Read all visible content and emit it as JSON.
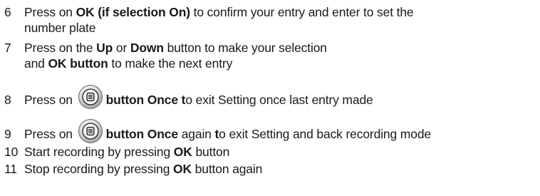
{
  "steps": [
    {
      "num": "6",
      "l1a": "Press on ",
      "l1b": "OK (if selection On)",
      "l1c": " to confirm your entry and enter to set the",
      "l2": "number plate"
    },
    {
      "num": "7",
      "l1a": "Press on the ",
      "l1b": "Up",
      "l1c": " or ",
      "l1d": "Down",
      "l1e": " button to make your selection",
      "l2a": "and ",
      "l2b": "OK button",
      "l2c": " to make the next entry"
    },
    {
      "num": "8",
      "pre": "Press on ",
      "bold": "button Once t",
      "post": "o exit Setting once last entry made",
      "icon": "menu-button-icon"
    },
    {
      "num": "9",
      "pre": "Press on ",
      "bold": "button Once",
      "mid": " again ",
      "bold2": "t",
      "post": "o exit Setting and back recording mode",
      "icon": "menu-button-icon"
    },
    {
      "num": "10",
      "pre": "Start recording by pressing ",
      "bold": "OK",
      "post": " button"
    },
    {
      "num": "11",
      "pre": "Stop recording by pressing ",
      "bold": "OK",
      "post": " button again"
    }
  ]
}
